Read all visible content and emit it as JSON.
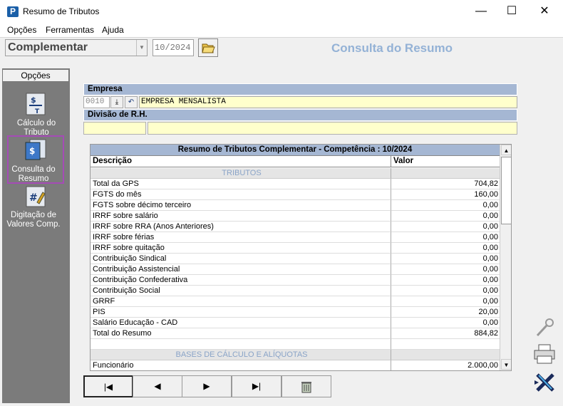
{
  "window": {
    "title": "Resumo de Tributos",
    "app_icon": "P",
    "minimize": "—",
    "maximize": "☐",
    "close": "✕"
  },
  "menu": [
    "Opções",
    "Ferramentas",
    "Ajuda"
  ],
  "toolbar": {
    "mode_value": "Complementar",
    "date_value": "10/2024",
    "header_title": "Consulta do Resumo"
  },
  "sidebar": {
    "tab_label": "Opções",
    "items": [
      {
        "label": "Cálculo do Tributo",
        "icon": "calculo-icon"
      },
      {
        "label": "Consulta do Resumo",
        "icon": "consulta-icon"
      },
      {
        "label": "Digitação de Valores Comp.",
        "icon": "digitacao-icon"
      }
    ]
  },
  "empresa": {
    "label": "Empresa",
    "code": "0010",
    "name": "EMPRESA MENSALISTA",
    "divisao_label": "Divisão de R.H."
  },
  "grid": {
    "title": "Resumo de Tributos Complementar - Competência : 10/2024",
    "col_desc": "Descrição",
    "col_val": "Valor",
    "rows": [
      {
        "desc": "TRIBUTOS",
        "val": "",
        "section": true
      },
      {
        "desc": "Total da GPS",
        "val": "704,82"
      },
      {
        "desc": "FGTS do mês",
        "val": "160,00"
      },
      {
        "desc": "FGTS sobre décimo terceiro",
        "val": "0,00"
      },
      {
        "desc": "IRRF sobre salário",
        "val": "0,00"
      },
      {
        "desc": "IRRF sobre RRA (Anos Anteriores)",
        "val": "0,00"
      },
      {
        "desc": "IRRF sobre férias",
        "val": "0,00"
      },
      {
        "desc": "IRRF sobre quitação",
        "val": "0,00"
      },
      {
        "desc": "Contribuição Sindical",
        "val": "0,00"
      },
      {
        "desc": "Contribuição Assistencial",
        "val": "0,00"
      },
      {
        "desc": "Contribuição Confederativa",
        "val": "0,00"
      },
      {
        "desc": "Contribuição Social",
        "val": "0,00"
      },
      {
        "desc": "GRRF",
        "val": "0,00"
      },
      {
        "desc": "PIS",
        "val": "20,00"
      },
      {
        "desc": "Salário Educação - CAD",
        "val": "0,00"
      },
      {
        "desc": "Total do Resumo",
        "val": "884,82"
      },
      {
        "desc": "",
        "val": ""
      },
      {
        "desc": "BASES DE CÁLCULO E ALÍQUOTAS",
        "val": "",
        "section": true
      },
      {
        "desc": "Funcionário",
        "val": "2.000,00"
      }
    ]
  },
  "nav": {
    "first": "|◀",
    "prev": "◀",
    "next": "▶",
    "last": "▶|"
  }
}
